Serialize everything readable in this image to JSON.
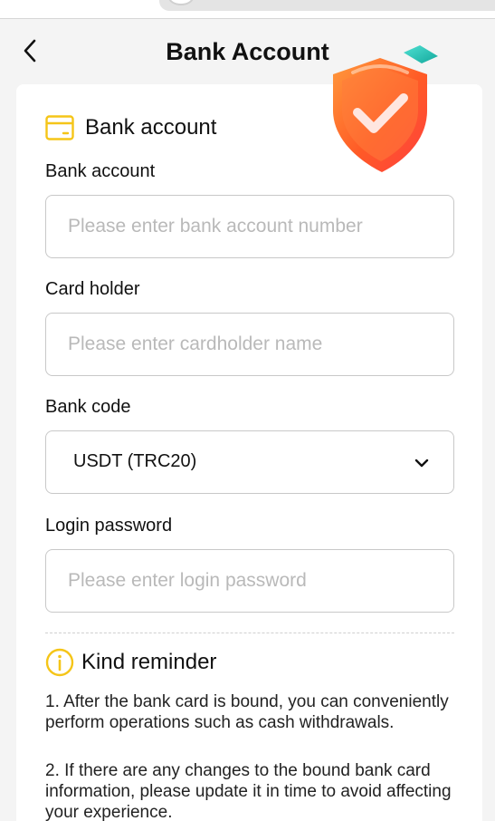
{
  "header": {
    "title": "Bank Account"
  },
  "section": {
    "title": "Bank account"
  },
  "fields": {
    "bank_account": {
      "label": "Bank account",
      "placeholder": "Please enter bank account number"
    },
    "card_holder": {
      "label": "Card holder",
      "placeholder": "Please enter cardholder name"
    },
    "bank_code": {
      "label": "Bank code",
      "selected": "USDT (TRC20)"
    },
    "login_password": {
      "label": "Login password",
      "placeholder": "Please enter login password"
    }
  },
  "reminder": {
    "title": "Kind reminder",
    "items": [
      "1. After the bank card is bound, you can conveniently perform operations such as cash withdrawals.",
      "2. If there are any changes to the bound bank card information, please update it in time to avoid affecting your experience."
    ]
  },
  "colors": {
    "accent_yellow": "#f5c518",
    "shield_orange": "#ff6a2b",
    "shield_teal": "#1fc2b5"
  },
  "icons": {
    "back": "chevron-left-icon",
    "section": "card-icon",
    "dropdown": "chevron-down-icon",
    "reminder": "info-icon",
    "badge": "shield-check-icon"
  }
}
